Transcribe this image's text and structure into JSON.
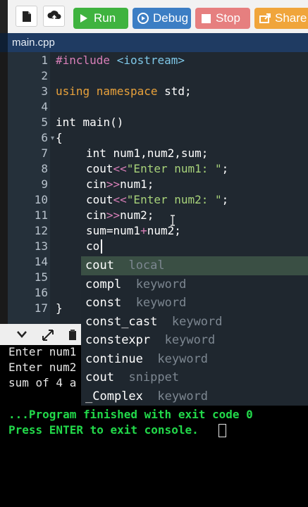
{
  "toolbar": {
    "run_label": "Run",
    "debug_label": "Debug",
    "stop_label": "Stop",
    "share_label": "Share",
    "colors": {
      "run": "#3fb33f",
      "debug": "#3c7ec4",
      "stop": "#e67f7f",
      "share": "#f0a53b"
    }
  },
  "tabs": [
    {
      "label": "main.cpp"
    }
  ],
  "editor": {
    "line_numbers": [
      "1",
      "2",
      "3",
      "4",
      "5",
      "6",
      "7",
      "8",
      "9",
      "10",
      "11",
      "12",
      "13",
      "14",
      "15",
      "16",
      "17"
    ],
    "lines": {
      "l1_directive": "#include",
      "l1_header": "<iostream>",
      "l3_using": "using namespace",
      "l3_std": " std;",
      "l5_int": "int",
      "l5_rest": " main()",
      "l6": "{",
      "l7_int": "int",
      "l7_rest": " num1,num2,sum;",
      "l8_cout": "cout",
      "l8_op": "<<",
      "l8_str": "\"Enter num1: \"",
      "l8_end": ";",
      "l9_cin": "cin",
      "l9_op": ">>",
      "l9_rest": "num1;",
      "l10_cout": "cout",
      "l10_op": "<<",
      "l10_str": "\"Enter num2: \"",
      "l10_end": ";",
      "l11_cin": "cin",
      "l11_op": ">>",
      "l11_rest": "num2;",
      "l12_a": "sum=num1",
      "l12_op": "+",
      "l12_b": "num2;",
      "l13": "co",
      "l17": "}"
    }
  },
  "autocomplete": [
    {
      "match": "co",
      "rest": "ut",
      "hint": "local"
    },
    {
      "match": "co",
      "rest": "mpl",
      "hint": "keyword"
    },
    {
      "match": "co",
      "rest": "nst",
      "hint": "keyword"
    },
    {
      "match": "co",
      "rest": "nst_cast",
      "hint": "keyword"
    },
    {
      "match": "co",
      "rest": "nstexpr",
      "hint": "keyword"
    },
    {
      "match": "co",
      "rest": "ntinue",
      "hint": "keyword"
    },
    {
      "match": "co",
      "rest": "ut",
      "hint": "snippet"
    },
    {
      "match": "_Co",
      "rest": "mplex",
      "hint": "keyword"
    }
  ],
  "console": {
    "line1": "Enter num1",
    "line2": "Enter num2",
    "line3": "sum of 4 a",
    "finish": "...Program finished with exit code 0",
    "press": "Press ENTER to exit console."
  }
}
